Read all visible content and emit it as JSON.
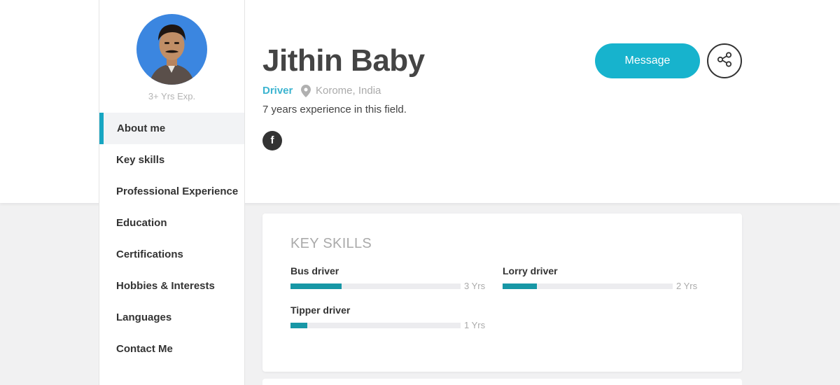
{
  "profile": {
    "experience_badge": "3+ Yrs Exp.",
    "name": "Jithin Baby",
    "role": "Driver",
    "location": "Korome, India",
    "description": "7 years experience in this field.",
    "facebook_label": "f"
  },
  "actions": {
    "message_label": "Message"
  },
  "nav": {
    "items": [
      {
        "label": "About me",
        "active": true
      },
      {
        "label": "Key skills"
      },
      {
        "label": "Professional Experience"
      },
      {
        "label": "Education"
      },
      {
        "label": "Certifications"
      },
      {
        "label": "Hobbies & Interests"
      },
      {
        "label": "Languages"
      },
      {
        "label": "Contact Me"
      }
    ]
  },
  "key_skills": {
    "title": "KEY SKILLS",
    "skills": [
      {
        "name": "Bus driver",
        "years_label": "3 Yrs",
        "level": 0.3
      },
      {
        "name": "Lorry driver",
        "years_label": "2 Yrs",
        "level": 0.2
      },
      {
        "name": "Tipper driver",
        "years_label": "1 Yrs",
        "level": 0.1
      }
    ]
  },
  "colors": {
    "accent": "#17b3cd",
    "skill_bar": "#1797a6",
    "role_text": "#3bb4d0"
  },
  "icons": {
    "location": "map-pin-icon",
    "share": "share-icon",
    "facebook": "facebook-icon"
  }
}
